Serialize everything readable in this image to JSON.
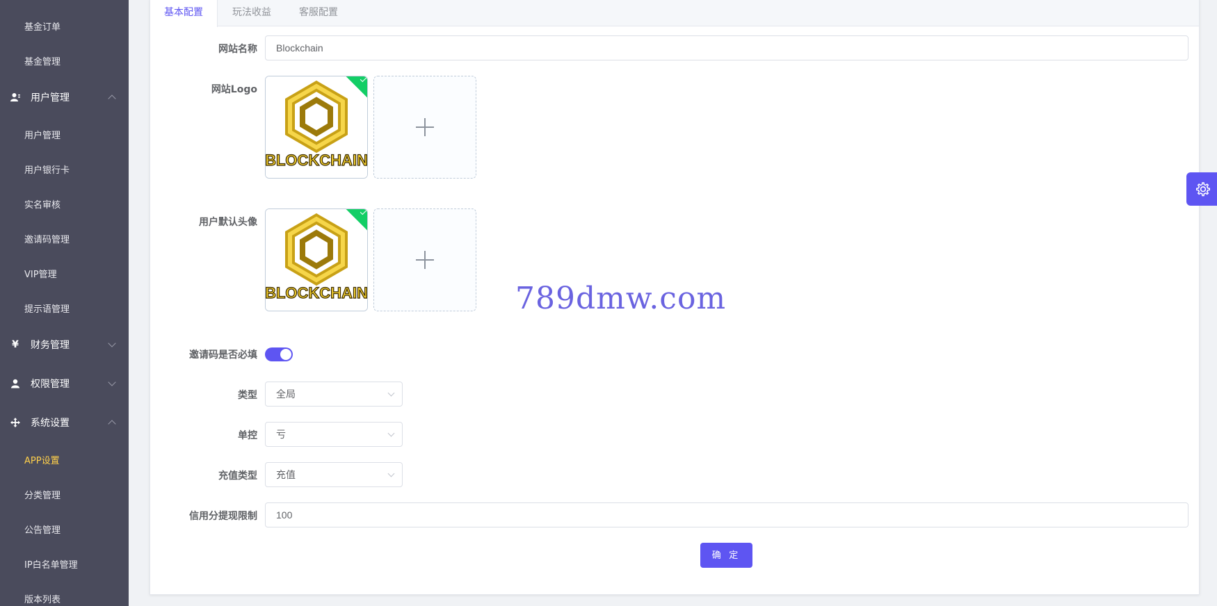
{
  "sidebar": {
    "items": [
      {
        "label": "基金订单",
        "type": "sub"
      },
      {
        "label": "基金管理",
        "type": "sub"
      },
      {
        "label": "用户管理",
        "type": "group",
        "icon": "user-icon",
        "expanded": true
      },
      {
        "label": "用户管理",
        "type": "sub"
      },
      {
        "label": "用户银行卡",
        "type": "sub"
      },
      {
        "label": "实名审核",
        "type": "sub"
      },
      {
        "label": "邀请码管理",
        "type": "sub"
      },
      {
        "label": "VIP管理",
        "type": "sub"
      },
      {
        "label": "提示语管理",
        "type": "sub"
      },
      {
        "label": "财务管理",
        "type": "group",
        "icon": "yen-icon",
        "expanded": false
      },
      {
        "label": "权限管理",
        "type": "group",
        "icon": "person-icon",
        "expanded": false
      },
      {
        "label": "系统设置",
        "type": "group",
        "icon": "move-icon",
        "expanded": true
      },
      {
        "label": "APP设置",
        "type": "sub",
        "active": true
      },
      {
        "label": "分类管理",
        "type": "sub"
      },
      {
        "label": "公告管理",
        "type": "sub"
      },
      {
        "label": "IP白名单管理",
        "type": "sub"
      },
      {
        "label": "版本列表",
        "type": "sub"
      }
    ]
  },
  "tabs": [
    {
      "label": "基本配置",
      "active": true
    },
    {
      "label": "玩法收益",
      "active": false
    },
    {
      "label": "客服配置",
      "active": false
    }
  ],
  "form": {
    "site_name": {
      "label": "网站名称",
      "value": "Blockchain"
    },
    "site_logo": {
      "label": "网站Logo",
      "image_text": "BLOCKCHAIN"
    },
    "default_avatar": {
      "label": "用户默认头像",
      "image_text": "BLOCKCHAIN"
    },
    "invite_required": {
      "label": "邀请码是否必填",
      "enabled": true
    },
    "type": {
      "label": "类型",
      "value": "全局"
    },
    "single_control": {
      "label": "单控",
      "value": "亏"
    },
    "recharge_type": {
      "label": "充值类型",
      "value": "充值"
    },
    "credit_limit": {
      "label": "信用分提现限制",
      "value": "100"
    },
    "submit_label": "确 定"
  },
  "watermark": "789dmw.com",
  "colors": {
    "accent": "#5e55f2",
    "sidebar": "#4a4b5c",
    "active_menu": "#ffd04b",
    "success": "#13ce66"
  }
}
